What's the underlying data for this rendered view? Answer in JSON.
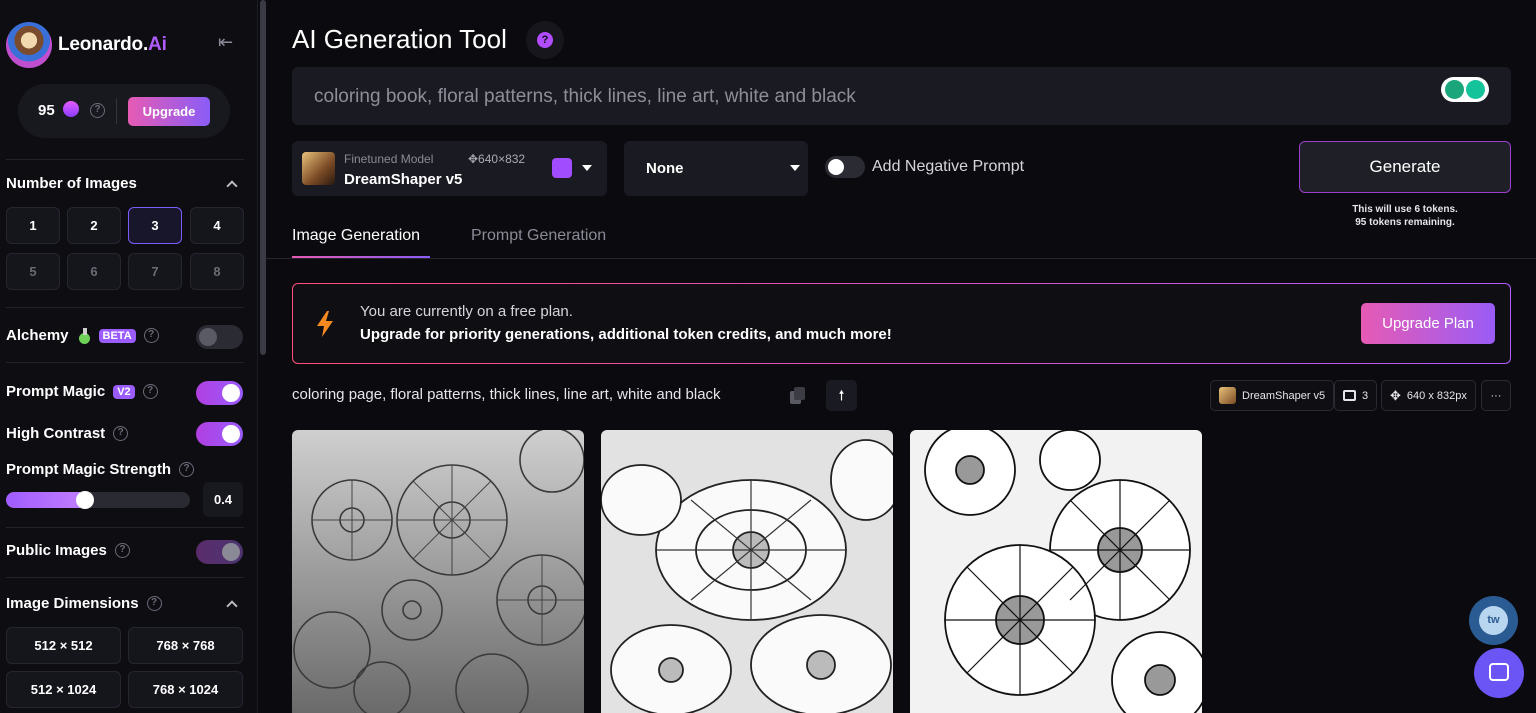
{
  "sidebar": {
    "brand_name": "Leonardo.",
    "brand_suffix": "Ai",
    "collapse_icon": "⇤",
    "tokens": "95",
    "upgrade_label": "Upgrade",
    "num_images_title": "Number of Images",
    "num_images": [
      "1",
      "2",
      "3",
      "4",
      "5",
      "6",
      "7",
      "8"
    ],
    "num_images_selected": "3",
    "alchemy_label": "Alchemy",
    "alchemy_badge": "BETA",
    "alchemy_enabled": false,
    "prompt_magic_label": "Prompt Magic",
    "prompt_magic_badge": "V2",
    "prompt_magic_enabled": true,
    "high_contrast_label": "High Contrast",
    "high_contrast_enabled": true,
    "prompt_magic_strength_label": "Prompt Magic Strength",
    "prompt_magic_strength_value": "0.4",
    "public_images_label": "Public Images",
    "public_images_enabled": true,
    "image_dimensions_title": "Image Dimensions",
    "dimensions": [
      "512 × 512",
      "768 × 768",
      "512 × 1024",
      "768 × 1024"
    ]
  },
  "header": {
    "title": "AI Generation Tool",
    "help_glyph": "?"
  },
  "prompt": {
    "value": "coloring book, floral patterns, thick lines, line art, white and black"
  },
  "model": {
    "caption": "Finetuned Model",
    "dims": "✥640×832",
    "name": "DreamShaper v5"
  },
  "style": {
    "value": "None"
  },
  "negative_prompt": {
    "label": "Add Negative Prompt",
    "enabled": false
  },
  "generate": {
    "label": "Generate",
    "note_line1": "This will use 6 tokens.",
    "note_line2": "95 tokens remaining."
  },
  "tabs": [
    {
      "label": "Image Generation",
      "active": true
    },
    {
      "label": "Prompt Generation",
      "active": false
    }
  ],
  "banner": {
    "line1": "You are currently on a free plan.",
    "line2": "Upgrade for priority generations, additional token credits, and much more!",
    "button": "Upgrade Plan"
  },
  "generation": {
    "prompt": "coloring page, floral patterns, thick lines, line art, white and black",
    "up_glyph": "🠕",
    "model_chip": "DreamShaper v5",
    "count_chip": "3",
    "size_chip": "640 x 832px",
    "more_glyph": "···"
  },
  "floating": {
    "tw_label": "tw"
  },
  "colors": {
    "accent_pink": "#e65bb4",
    "accent_purple": "#8a5cf6",
    "background": "#0b0b0f"
  }
}
